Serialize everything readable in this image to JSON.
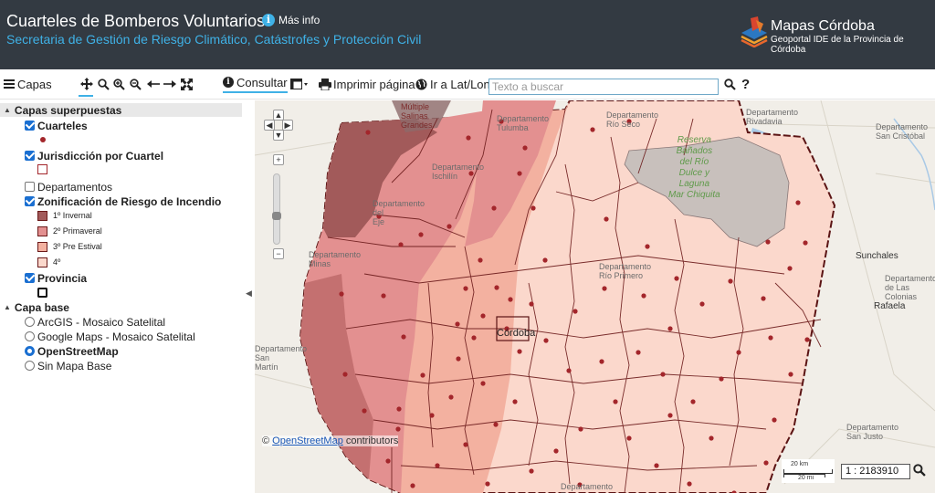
{
  "header": {
    "title": "Cuarteles de Bomberos Voluntarios",
    "subtitle": "Secretaria de Gestión de Riesgo Climático, Catástrofes y Protección Civil",
    "info_label": "Más info",
    "logo_title": "Mapas Córdoba",
    "logo_subtitle": "Geoportal IDE de la Provincia de Córdoba"
  },
  "toolbar": {
    "capas_label": "Capas",
    "consultar_label": "Consultar",
    "print_label": "Imprimir página",
    "latlon_label": "Ir a Lat/Lon",
    "search_placeholder": "Texto a buscar",
    "help_label": "?"
  },
  "layers": {
    "overlay_header": "Capas superpuestas",
    "overlays": [
      {
        "label": "Cuarteles",
        "checked": true
      },
      {
        "label": "Jurisdicción por Cuartel",
        "checked": true
      },
      {
        "label": "Departamentos",
        "checked": false
      },
      {
        "label": "Zonificación de Riesgo de Incendio",
        "checked": true
      },
      {
        "label": "Provincia",
        "checked": true
      }
    ],
    "zones": [
      {
        "label": "1º Invernal",
        "color": "#a25a5a"
      },
      {
        "label": "2º Primaveral",
        "color": "#e39090"
      },
      {
        "label": "3º Pre Estival",
        "color": "#f3b1a0"
      },
      {
        "label": "4º",
        "color": "#fbd8cc"
      }
    ],
    "base_header": "Capa base",
    "bases": [
      {
        "label": "ArcGIS - Mosaico Satelital",
        "selected": false
      },
      {
        "label": "Google Maps - Mosaico Satelital",
        "selected": false
      },
      {
        "label": "OpenStreetMap",
        "selected": true
      },
      {
        "label": "Sin Mapa Base",
        "selected": false
      }
    ]
  },
  "map": {
    "labels": {
      "multiple_salinas": "Múltiple\nSalinas\nGrandes",
      "reserva": "Reserva\nBañados\ndel Río\nDulce y\nLaguna\nMar Chiquita",
      "depto_rio_seco": "Departamento\nRío Seco",
      "depto_tulumba": "Departamento\nTulumba",
      "depto_rivadavia": "Departamento\nRivadavia",
      "depto_san_cristobal": "Departamento\nSan Cristóbal",
      "depto_ischilin": "Departamento\nIschilín",
      "depto_cruz_del_eje": "Departamento\ndel\nEje",
      "depto_minas": "Departamento\nMinas",
      "depto_rio_primero": "Departamento\nRío Primero",
      "depto_san_martin": "Departamento\nSan\nMartín",
      "depto_san_justo": "Departamento\nSan Justo",
      "depto_tercero": "Departamento\nTercero",
      "depto_castellanos": "Departamento\nde Las\nColonias",
      "sunchales": "Sunchales",
      "rafaela": "Rafaela",
      "cordoba": "Córdoba"
    },
    "attribution_symbol": "©",
    "attribution_link": "OpenStreetMap",
    "attribution_rest": " contributors",
    "scale_km": "20 km",
    "scale_mi": "20 mi",
    "scale_value": "1 : 2183910",
    "colors": {
      "winter": "#a25a5a",
      "spring": "#e39090",
      "preestival": "#f3b1a0",
      "fourth": "#fbd8cc",
      "boundary": "#6b1a1a",
      "station": "#a3262b"
    }
  }
}
